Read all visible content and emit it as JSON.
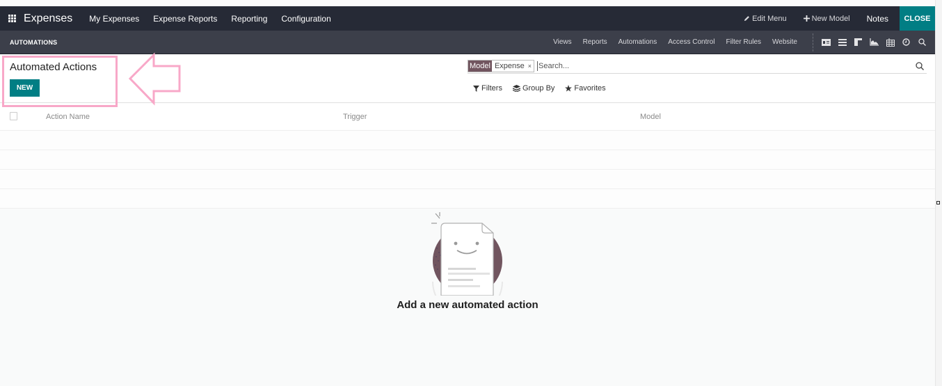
{
  "navbar": {
    "app_name": "Expenses",
    "menu": [
      "My Expenses",
      "Expense Reports",
      "Reporting",
      "Configuration"
    ],
    "edit_menu": "Edit Menu",
    "new_model": "New Model",
    "notes": "Notes",
    "close": "CLOSE",
    "accent_color": "#017e84"
  },
  "subbar": {
    "title": "AUTOMATIONS",
    "links": [
      "Views",
      "Reports",
      "Automations",
      "Access Control",
      "Filter Rules",
      "Website"
    ],
    "view_icons": [
      "id-card-icon",
      "list-icon",
      "kanban-icon",
      "area-chart-icon",
      "table-icon",
      "clock-icon",
      "search-icon"
    ]
  },
  "control": {
    "page_title": "Automated Actions",
    "new_button": "NEW",
    "search": {
      "facet_label": "Model",
      "facet_value": "Expense",
      "facet_close": "×",
      "placeholder": "Search..."
    },
    "filters": {
      "filters": "Filters",
      "group_by": "Group By",
      "favorites": "Favorites"
    }
  },
  "list": {
    "columns": [
      "Action Name",
      "Trigger",
      "Model"
    ],
    "rows": []
  },
  "empty_state": {
    "title": "Add a new automated action"
  },
  "annotation": {
    "color": "#f8a8c8"
  }
}
